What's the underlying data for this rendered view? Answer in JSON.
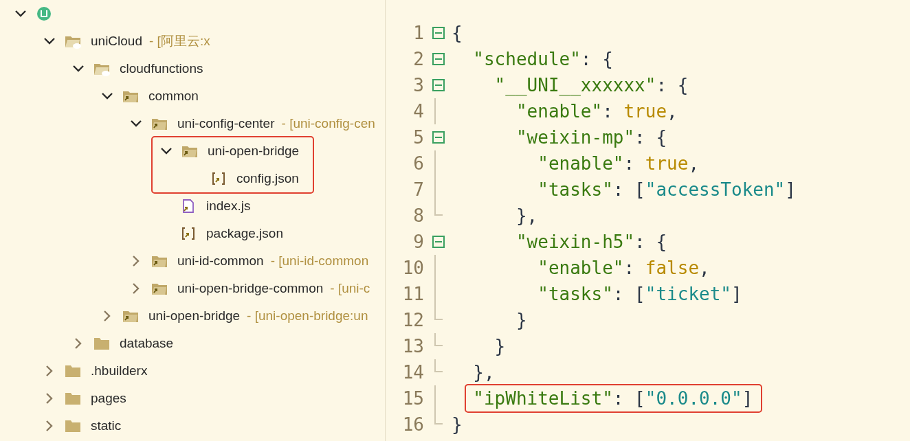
{
  "tree": [
    {
      "kind": "project",
      "expanded": true,
      "children": [
        {
          "name": "uniCloud",
          "note": "- [阿里云:x",
          "kind": "cloud-folder",
          "expanded": true,
          "children": [
            {
              "name": "cloudfunctions",
              "kind": "cloud-folder",
              "expanded": true,
              "children": [
                {
                  "name": "common",
                  "kind": "link-folder",
                  "expanded": true,
                  "children": [
                    {
                      "name": "uni-config-center",
                      "note": "- [uni-config-cen",
                      "kind": "link-folder",
                      "expanded": true,
                      "children": [
                        {
                          "name": "uni-open-bridge",
                          "kind": "link-folder",
                          "expanded": true,
                          "annotated": true,
                          "children": [
                            {
                              "name": "config.json",
                              "kind": "json-file"
                            }
                          ]
                        },
                        {
                          "name": "index.js",
                          "kind": "js-file"
                        },
                        {
                          "name": "package.json",
                          "kind": "json-file"
                        }
                      ]
                    },
                    {
                      "name": "uni-id-common",
                      "note": "- [uni-id-common",
                      "kind": "link-folder",
                      "expanded": false
                    },
                    {
                      "name": "uni-open-bridge-common",
                      "note": "- [uni-c",
                      "kind": "link-folder",
                      "expanded": false
                    }
                  ]
                },
                {
                  "name": "uni-open-bridge",
                  "note": "- [uni-open-bridge:un",
                  "kind": "link-folder",
                  "expanded": false
                }
              ]
            },
            {
              "name": "database",
              "kind": "folder",
              "expanded": false
            }
          ]
        },
        {
          "name": ".hbuilderx",
          "kind": "folder",
          "expanded": false
        },
        {
          "name": "pages",
          "kind": "folder",
          "expanded": false
        },
        {
          "name": "static",
          "kind": "folder",
          "expanded": false
        }
      ]
    }
  ],
  "editor": {
    "lines": [
      {
        "number": "1",
        "kind": "fold-start",
        "tokens": [
          {
            "kind": "punct",
            "text": "{"
          }
        ]
      },
      {
        "number": "2",
        "kind": "fold-start",
        "tokens": [
          {
            "kind": "key",
            "text": "  \"schedule\""
          },
          {
            "kind": "punct",
            "text": ": {"
          }
        ]
      },
      {
        "number": "3",
        "kind": "fold-start",
        "tokens": [
          {
            "kind": "key",
            "text": "    \"__UNI__xxxxxx\""
          },
          {
            "kind": "punct",
            "text": ": {"
          }
        ]
      },
      {
        "number": "4",
        "kind": "guide",
        "tokens": [
          {
            "kind": "key",
            "text": "      \"enable\""
          },
          {
            "kind": "punct",
            "text": ": "
          },
          {
            "kind": "literal",
            "text": "true"
          },
          {
            "kind": "punct",
            "text": ","
          }
        ]
      },
      {
        "number": "5",
        "kind": "fold-start",
        "tokens": [
          {
            "kind": "key",
            "text": "      \"weixin-mp\""
          },
          {
            "kind": "punct",
            "text": ": {"
          }
        ]
      },
      {
        "number": "6",
        "kind": "guide",
        "tokens": [
          {
            "kind": "key",
            "text": "        \"enable\""
          },
          {
            "kind": "punct",
            "text": ": "
          },
          {
            "kind": "literal",
            "text": "true"
          },
          {
            "kind": "punct",
            "text": ","
          }
        ]
      },
      {
        "number": "7",
        "kind": "guide",
        "tokens": [
          {
            "kind": "key",
            "text": "        \"tasks\""
          },
          {
            "kind": "punct",
            "text": ": ["
          },
          {
            "kind": "string",
            "text": "\"accessToken\""
          },
          {
            "kind": "punct",
            "text": "]"
          }
        ]
      },
      {
        "number": "8",
        "kind": "fold-end",
        "tokens": [
          {
            "kind": "punct",
            "text": "      },"
          }
        ]
      },
      {
        "number": "9",
        "kind": "fold-start",
        "tokens": [
          {
            "kind": "key",
            "text": "      \"weixin-h5\""
          },
          {
            "kind": "punct",
            "text": ": {"
          }
        ]
      },
      {
        "number": "10",
        "kind": "guide",
        "tokens": [
          {
            "kind": "key",
            "text": "        \"enable\""
          },
          {
            "kind": "punct",
            "text": ": "
          },
          {
            "kind": "literal",
            "text": "false"
          },
          {
            "kind": "punct",
            "text": ","
          }
        ]
      },
      {
        "number": "11",
        "kind": "guide",
        "tokens": [
          {
            "kind": "key",
            "text": "        \"tasks\""
          },
          {
            "kind": "punct",
            "text": ": ["
          },
          {
            "kind": "string",
            "text": "\"ticket\""
          },
          {
            "kind": "punct",
            "text": "]"
          }
        ]
      },
      {
        "number": "12",
        "kind": "fold-end",
        "tokens": [
          {
            "kind": "punct",
            "text": "      }"
          }
        ]
      },
      {
        "number": "13",
        "kind": "fold-end",
        "tokens": [
          {
            "kind": "punct",
            "text": "    }"
          }
        ]
      },
      {
        "number": "14",
        "kind": "fold-end",
        "tokens": [
          {
            "kind": "punct",
            "text": "  },"
          }
        ]
      },
      {
        "number": "15",
        "kind": "guide",
        "annotated": true,
        "tokens": [
          {
            "kind": "key",
            "text": "\"ipWhiteList\""
          },
          {
            "kind": "punct",
            "text": ": ["
          },
          {
            "kind": "string",
            "text": "\"0.0.0.0\""
          },
          {
            "kind": "punct",
            "text": "]"
          }
        ]
      },
      {
        "number": "16",
        "kind": "fold-end",
        "tokens": [
          {
            "kind": "punct",
            "text": "}"
          }
        ]
      }
    ]
  }
}
